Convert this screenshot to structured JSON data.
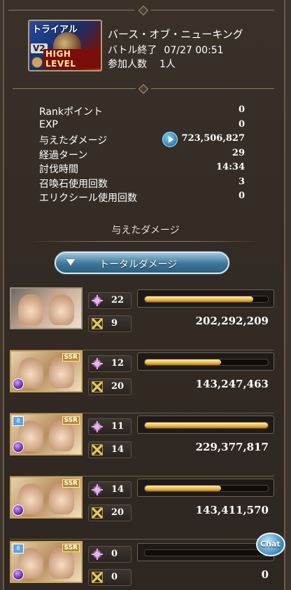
{
  "quest": {
    "badge_text": "トライアル",
    "version": "V2",
    "level_text": "HIGH LEVEL",
    "title": "バース・オブ・ニューキング",
    "status": "バトル終了",
    "datetime": "07/27 00:51",
    "participants_label": "参加人数",
    "participants_value": "1人"
  },
  "stats": [
    {
      "label": "Rankポイント",
      "value": "0"
    },
    {
      "label": "EXP",
      "value": "0"
    },
    {
      "label": "与えたダメージ",
      "value": "723,506,827"
    },
    {
      "label": "経過ターン",
      "value": "29"
    },
    {
      "label": "討伐時間",
      "value": "14:34"
    },
    {
      "label": "召喚石使用回数",
      "value": "3"
    },
    {
      "label": "エリクシール使用回数",
      "value": "0"
    }
  ],
  "section_title": "与えたダメージ",
  "dropdown_label": "トータルダメージ",
  "members": [
    {
      "hits": "22",
      "turns": "9",
      "damage": "202,292,209",
      "bar_fill": 0.88
    },
    {
      "hits": "12",
      "turns": "20",
      "damage": "143,247,463",
      "bar_fill": 0.62
    },
    {
      "hits": "11",
      "turns": "14",
      "damage": "229,377,817",
      "bar_fill": 1.0
    },
    {
      "hits": "14",
      "turns": "20",
      "damage": "143,411,570",
      "bar_fill": 0.62
    },
    {
      "hits": "0",
      "turns": "0",
      "damage": "0",
      "bar_fill": 0.0
    }
  ],
  "chat_label": "Chat",
  "icons": {
    "damage_play": "play-icon",
    "hits": "sparkle-icon",
    "turns": "crossed-swords-icon",
    "dropdown": "triangle-down-icon"
  }
}
